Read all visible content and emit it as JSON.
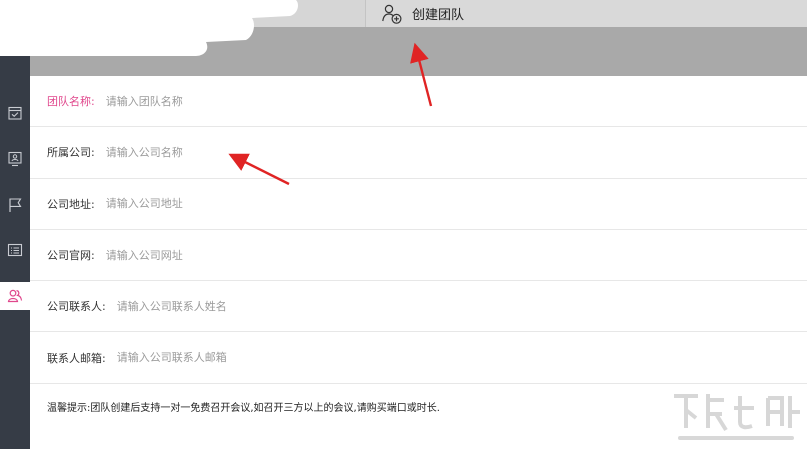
{
  "tabs": {
    "create_team_label": "创建团队"
  },
  "form": {
    "fields": [
      {
        "label": "团队名称:",
        "placeholder": "请输入团队名称",
        "required": true
      },
      {
        "label": "所属公司:",
        "placeholder": "请输入公司名称",
        "required": false
      },
      {
        "label": "公司地址:",
        "placeholder": "请输入公司地址",
        "required": false
      },
      {
        "label": "公司官网:",
        "placeholder": "请输入公司网址",
        "required": false
      },
      {
        "label": "公司联系人:",
        "placeholder": "请输入公司联系人姓名",
        "required": false
      },
      {
        "label": "联系人邮箱:",
        "placeholder": "请输入公司联系人邮箱",
        "required": false
      }
    ],
    "hint": "温馨提示:团队创建后支持一对一免费召开会议,如召开三方以上的会议,请购买端口或时长."
  },
  "sidebar": {
    "items": [
      {
        "icon": "calendar-check-icon"
      },
      {
        "icon": "monitor-user-icon"
      },
      {
        "icon": "flag-icon"
      },
      {
        "icon": "list-icon"
      },
      {
        "icon": "team-icon",
        "active": true
      }
    ]
  },
  "colors": {
    "sidebar_bg": "#363c46",
    "header_band": "#a9a9a9",
    "required_label": "#e0478c",
    "active_icon": "#e0478c",
    "annotation_arrow": "#e02424"
  }
}
